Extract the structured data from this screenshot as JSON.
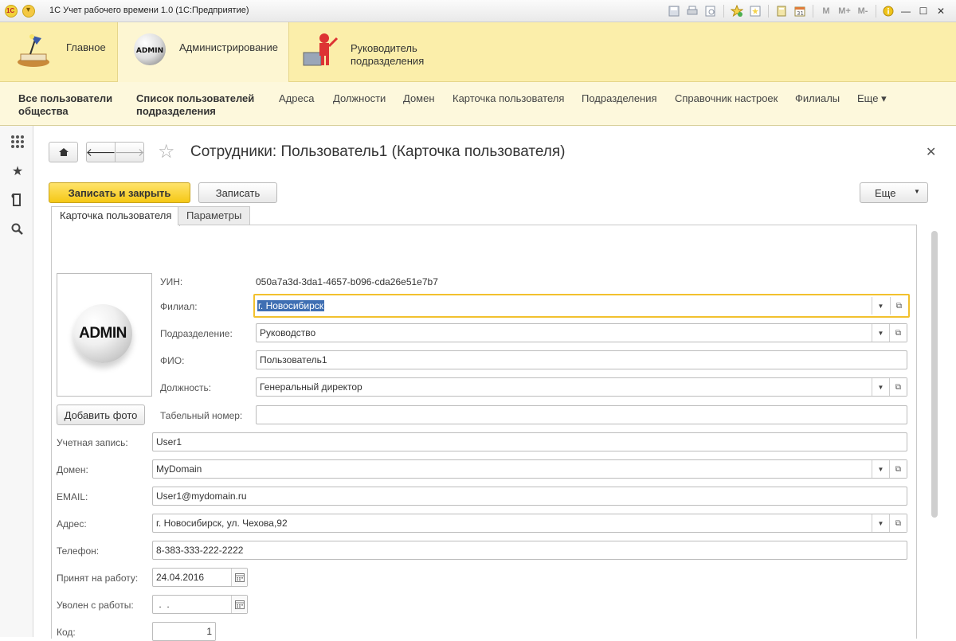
{
  "window": {
    "title": "1С Учет рабочего времени 1.0  (1С:Предприятие)"
  },
  "titlebar_icons": [
    "save-icon",
    "print-icon",
    "preview-icon",
    "favorites-add-icon",
    "history-icon",
    "calculator-icon",
    "calendar-icon"
  ],
  "memory_buttons": [
    "M",
    "M+",
    "M-"
  ],
  "sections": [
    {
      "label": "Главное",
      "icon": "desk-lamp-icon"
    },
    {
      "label": "Администрирование",
      "icon": "admin-icon",
      "active": true
    },
    {
      "label_line1": "Руководитель",
      "label_line2": "подразделения",
      "icon": "manager-icon"
    }
  ],
  "functions": {
    "all_users_line1": "Все пользователи",
    "all_users_line2": "общества",
    "unit_users_line1": "Список пользователей",
    "unit_users_line2": "подразделения",
    "items": [
      "Адреса",
      "Должности",
      "Домен",
      "Карточка пользователя",
      "Подразделения",
      "Справочник настроек",
      "Филиалы"
    ],
    "more": "Еще ▾"
  },
  "form": {
    "title": "Сотрудники: Пользователь1 (Карточка пользователя)",
    "save_close": "Записать и закрыть",
    "save": "Записать",
    "more": "Еще",
    "tabs": [
      "Карточка пользователя",
      "Параметры"
    ],
    "photo_text": "ADMIN",
    "add_photo": "Добавить фото",
    "fields": {
      "uin_label": "УИН:",
      "uin_value": "050a7a3d-3da1-4657-b096-cda26e51e7b7",
      "branch_label": "Филиал:",
      "branch_value": "г. Новосибирск",
      "department_label": "Подразделение:",
      "department_value": "Руководство",
      "fio_label": "ФИО:",
      "fio_value": "Пользователь1",
      "position_label": "Должность:",
      "position_value": "Генеральный директор",
      "tab_number_label": "Табельный номер:",
      "tab_number_value": "",
      "account_label": "Учетная запись:",
      "account_value": "User1",
      "domain_label": "Домен:",
      "domain_value": "MyDomain",
      "email_label": "EMAIL:",
      "email_value": "User1@mydomain.ru",
      "address_label": "Адрес:",
      "address_value": "г. Новосибирск, ул. Чехова,92",
      "phone_label": "Телефон:",
      "phone_value": "8-383-333-222-2222",
      "hired_label": "Принят на работу:",
      "hired_value": "24.04.2016",
      "fired_label": "Уволен с работы:",
      "fired_value": " .  .",
      "code_label": "Код:",
      "code_value": "1"
    }
  }
}
